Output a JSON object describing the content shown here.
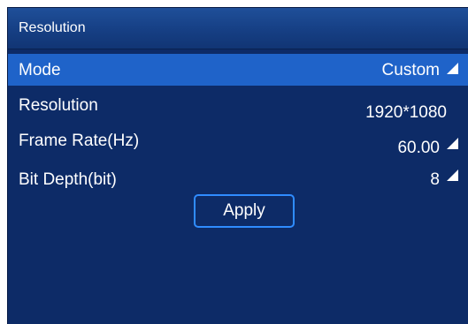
{
  "panel": {
    "title": "Resolution"
  },
  "rows": [
    {
      "label": "Mode",
      "value": "Custom",
      "selected": true,
      "dropdown": true
    },
    {
      "label": "Resolution",
      "value": "1920*1080",
      "selected": false,
      "dropdown": false
    },
    {
      "label": "Frame Rate(Hz)",
      "value": "60.00",
      "selected": false,
      "dropdown": true
    },
    {
      "label": "Bit Depth(bit)",
      "value": "8",
      "selected": false,
      "dropdown": true
    }
  ],
  "apply_label": "Apply",
  "colors": {
    "panel_background": "#0d2b67",
    "title_bar": "#1f4f99",
    "selected_row": "#1f63c9",
    "button_border": "#2f8cff",
    "text": "#ffffff"
  },
  "icons": {
    "dropdown_indicator": "corner-triangle-icon"
  }
}
